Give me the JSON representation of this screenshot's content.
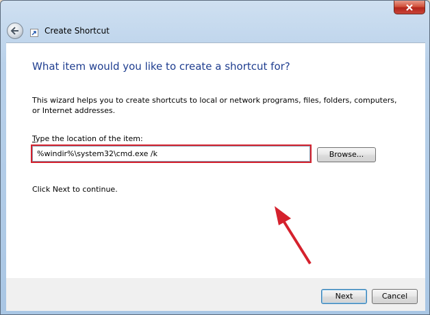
{
  "window": {
    "title": "Create Shortcut"
  },
  "page": {
    "heading": "What item would you like to create a shortcut for?",
    "description": "This wizard helps you to create shortcuts to local or network programs, files, folders, computers, or Internet addresses.",
    "location_label_accel": "T",
    "location_label_rest": "ype the location of the item:",
    "location_value": "%windir%\\system32\\cmd.exe /k",
    "browse_label": "Browse...",
    "continue_text": "Click Next to continue."
  },
  "footer": {
    "next_label": "Next",
    "cancel_label": "Cancel"
  },
  "colors": {
    "heading": "#1e3d8f",
    "highlight": "#d5212d"
  },
  "icons": [
    "back-arrow-icon",
    "shortcut-icon",
    "close-icon",
    "annotation-arrow-icon"
  ]
}
